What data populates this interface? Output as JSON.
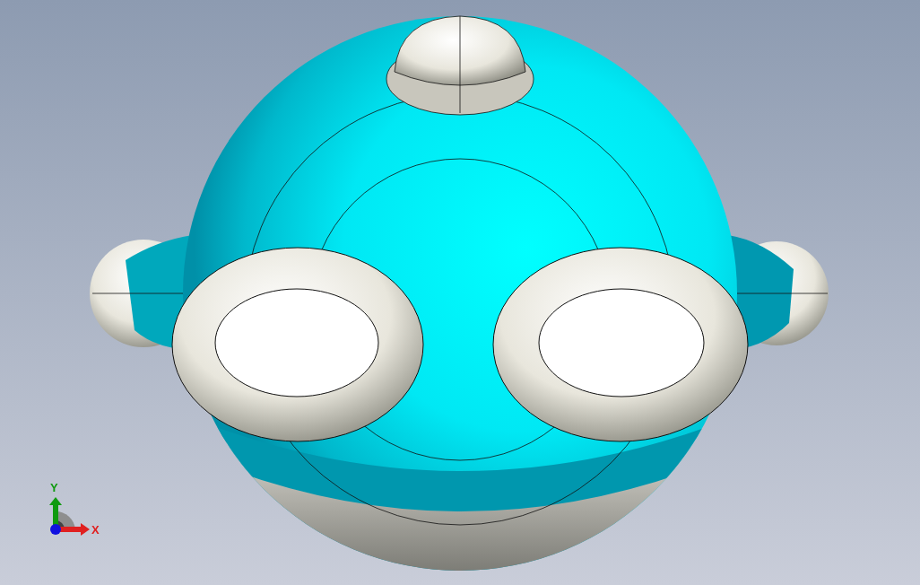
{
  "triad": {
    "axes": [
      {
        "kind": "y",
        "label": "Y",
        "color": "#0f9a0f"
      },
      {
        "kind": "x",
        "label": "X",
        "color": "#e02020"
      }
    ]
  }
}
